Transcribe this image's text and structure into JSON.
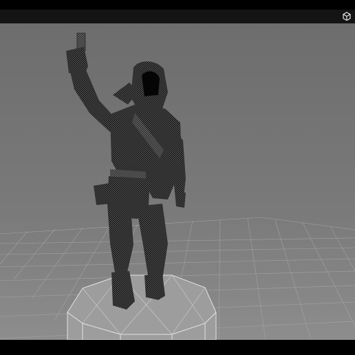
{
  "viewer": {
    "toolbar_icon": "3d-cube-icon",
    "scene": {
      "model": "hooded-soldier-wireframe-figure",
      "grid_floor": true,
      "pedestal": "octagonal-base"
    },
    "colors": {
      "background_top": "#6f6f6f",
      "background_bottom": "#8a8a8a",
      "grid_line": "#a8a8a8",
      "model_fill": "#1b1b1b",
      "pedestal_fill": "#9c9c9c",
      "bars": "#000000"
    }
  }
}
